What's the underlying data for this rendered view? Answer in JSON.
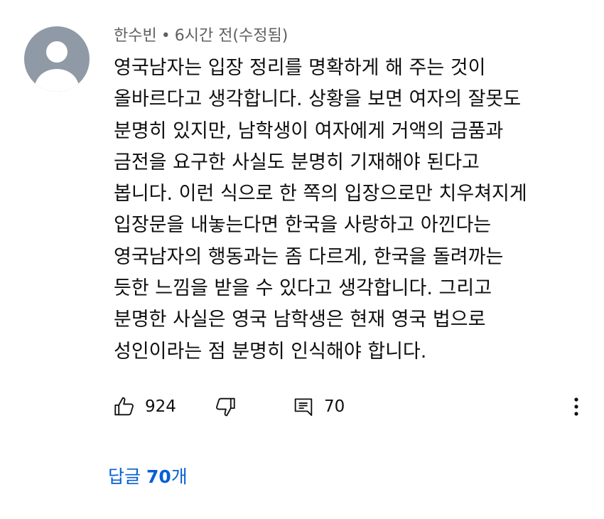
{
  "comment": {
    "author": "한수빈",
    "separator": "•",
    "time": "6시간 전(수정됨)",
    "text_lines": [
      "영국남자는 입장 정리를 명확하게 해 주는 것이",
      "올바르다고 생각합니다. 상황을 보면 여자의 잘못도",
      "분명히 있지만, 남학생이 여자에게 거액의 금품과",
      "금전을 요구한 사실도 분명히 기재해야 된다고",
      "봅니다. 이런 식으로 한 쪽의 입장으로만 치우쳐지게",
      "입장문을 내놓는다면 한국을 사랑하고 아낀다는",
      "영국남자의 행동과는 좀 다르게, 한국을 돌려까는",
      "듯한 느낌을 받을 수 있다고 생각합니다. 그리고",
      "분명한 사실은 영국 남학생은 현재 영국 법으로",
      "성인이라는 점 분명히 인식해야 합니다."
    ]
  },
  "actions": {
    "like_icon": "thumbs-up-icon",
    "like_count": "924",
    "dislike_icon": "thumbs-down-icon",
    "reply_icon": "comment-reply-icon",
    "reply_count": "70",
    "more_icon": "more-vert-icon"
  },
  "replies": {
    "prefix": "답글",
    "count": "70",
    "suffix": "개",
    "color": "#065fd4"
  },
  "colors": {
    "avatar_bg": "#909aa6",
    "avatar_fg": "#ffffff",
    "meta_text": "#606060",
    "body_text": "#0f0f0f"
  }
}
